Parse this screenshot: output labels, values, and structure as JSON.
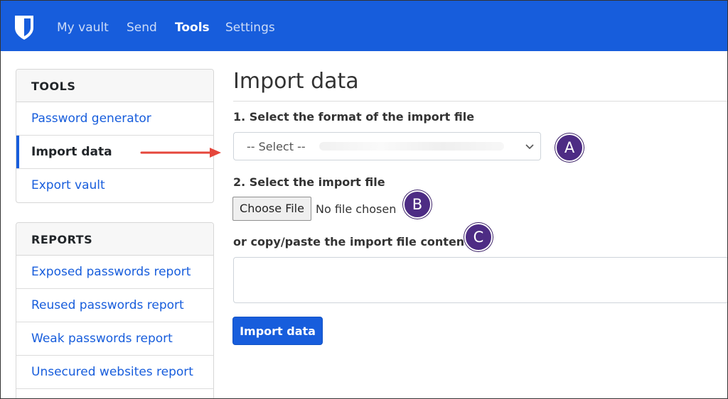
{
  "nav": {
    "items": [
      {
        "label": "My vault",
        "active": false
      },
      {
        "label": "Send",
        "active": false
      },
      {
        "label": "Tools",
        "active": true
      },
      {
        "label": "Settings",
        "active": false
      }
    ]
  },
  "sidebar": {
    "tools": {
      "header": "TOOLS",
      "items": [
        "Password generator",
        "Import data",
        "Export vault"
      ]
    },
    "reports": {
      "header": "REPORTS",
      "items": [
        "Exposed passwords report",
        "Reused passwords report",
        "Weak passwords report",
        "Unsecured websites report"
      ]
    }
  },
  "main": {
    "title": "Import data",
    "step1_label": "1. Select the format of the import file",
    "format_select_value": "-- Select --",
    "step2_label": "2. Select the import file",
    "file_button_label": "Choose File",
    "file_status": "No file chosen",
    "paste_label": "or copy/paste the import file contents",
    "import_button_label": "Import data"
  },
  "annotations": {
    "a": "A",
    "b": "B",
    "c": "C"
  },
  "colors": {
    "brand_blue": "#175ddc",
    "badge_purple": "#4d2c84",
    "arrow_red": "#e5463b"
  }
}
